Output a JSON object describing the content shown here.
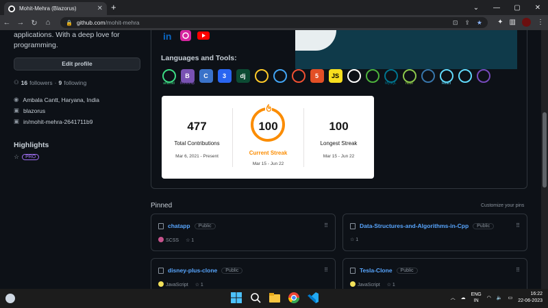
{
  "browser": {
    "tab_title": "Mohit-Mehra (Blazorus)",
    "tab_close": "✕",
    "new_tab": "+",
    "url_domain": "github.com",
    "url_path": "/mohit-mehra",
    "window_controls": [
      "⌄",
      "—",
      "▢",
      "✕"
    ]
  },
  "profile": {
    "bio": "applications. With a deep love for programming.",
    "edit_profile": "Edit profile",
    "followers_count": "16",
    "followers_label": "followers",
    "separator": "·",
    "following_count": "9",
    "following_label": "following",
    "location": "Ambala Cantt, Haryana, India",
    "username": "blazorus",
    "linkedin": "in/mohit-mehra-2641711b9",
    "highlights_title": "Highlights",
    "pro_badge": "PRO"
  },
  "readme": {
    "languages_title": "Languages and Tools:",
    "tools": [
      {
        "name": "android",
        "label": "android",
        "glyph": "",
        "color": "#3ddc84"
      },
      {
        "name": "bootstrap",
        "label": "Bootstrap",
        "glyph": "B",
        "color": "#7952b3"
      },
      {
        "name": "c",
        "label": "",
        "glyph": "C",
        "color": "#3a72c9"
      },
      {
        "name": "css3",
        "label": "",
        "glyph": "3",
        "color": "#2965f1"
      },
      {
        "name": "django",
        "label": "",
        "glyph": "dj",
        "color": "#0c4b33"
      },
      {
        "name": "firebase",
        "label": "",
        "glyph": "",
        "color": "#ffca28"
      },
      {
        "name": "flutter",
        "label": "",
        "glyph": "",
        "color": "#42a5f5"
      },
      {
        "name": "git",
        "label": "",
        "glyph": "",
        "color": "#f05032"
      },
      {
        "name": "html5",
        "label": "",
        "glyph": "5",
        "color": "#e34f26"
      },
      {
        "name": "javascript",
        "label": "",
        "glyph": "JS",
        "color": "#f7df1e"
      },
      {
        "name": "linux",
        "label": "",
        "glyph": "",
        "color": "#ffffff"
      },
      {
        "name": "mongodb",
        "label": "",
        "glyph": "",
        "color": "#4db33d"
      },
      {
        "name": "mysql",
        "label": "MySQL",
        "glyph": "",
        "color": "#00758f"
      },
      {
        "name": "nodejs",
        "label": "node",
        "glyph": "",
        "color": "#8cc84b"
      },
      {
        "name": "python",
        "label": "",
        "glyph": "",
        "color": "#3776ab"
      },
      {
        "name": "react",
        "label": "React",
        "glyph": "",
        "color": "#61dafb"
      },
      {
        "name": "react-native",
        "label": "",
        "glyph": "",
        "color": "#61dafb"
      },
      {
        "name": "redux",
        "label": "",
        "glyph": "",
        "color": "#764abc"
      }
    ],
    "stats": {
      "total_value": "477",
      "total_label": "Total Contributions",
      "total_range": "Mar 6, 2021 - Present",
      "current_value": "100",
      "current_label": "Current Streak",
      "current_range": "Mar 15 - Jun 22",
      "longest_value": "100",
      "longest_label": "Longest Streak",
      "longest_range": "Mar 15 - Jun 22"
    }
  },
  "pinned": {
    "title": "Pinned",
    "customize": "Customize your pins",
    "repos": [
      {
        "name": "chatapp",
        "visibility": "Public",
        "language": "SCSS",
        "lang_color": "#c6538c",
        "stars": "1"
      },
      {
        "name": "Data-Structures-and-Algorithms-in-Cpp",
        "visibility": "Public",
        "language": "",
        "lang_color": "",
        "stars": "1"
      },
      {
        "name": "disney-plus-clone",
        "visibility": "Public",
        "language": "JavaScript",
        "lang_color": "#f1e05a",
        "stars": "1"
      },
      {
        "name": "Tesla-Clone",
        "visibility": "Public",
        "language": "JavaScript",
        "lang_color": "#f1e05a",
        "stars": "1"
      }
    ]
  },
  "taskbar": {
    "lang_top": "ENG",
    "lang_bottom": "IN",
    "time": "16:22",
    "date": "22-06-2023"
  },
  "colors": {
    "accent_link": "#58a6ff",
    "streak_orange": "#fb8c00",
    "background": "#0d1117"
  }
}
